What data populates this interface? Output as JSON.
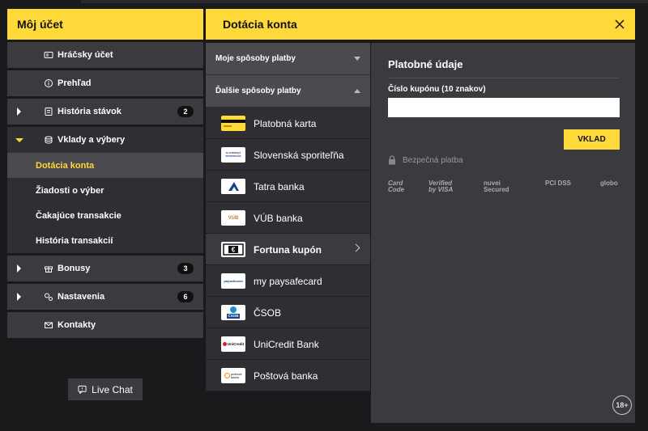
{
  "left_panel": {
    "title": "Môj účet",
    "items": [
      {
        "label": "Hráčsky účet"
      },
      {
        "label": "Prehľad"
      },
      {
        "label": "História stávok",
        "badge": "2"
      },
      {
        "label": "Vklady a výbery"
      },
      {
        "label": "Bonusy",
        "badge": "3"
      },
      {
        "label": "Nastavenia",
        "badge": "6"
      },
      {
        "label": "Kontakty"
      }
    ],
    "submenu": [
      {
        "label": "Dotácia konta"
      },
      {
        "label": "Žiadosti o výber"
      },
      {
        "label": "Čakajúce transakcie"
      },
      {
        "label": "História transakcií"
      }
    ],
    "live_chat": "Live Chat"
  },
  "right_panel": {
    "title": "Dotácia konta",
    "groups": {
      "my_methods": "Moje spôsoby platby",
      "other_methods": "Ďalšie spôsoby platby"
    },
    "methods": [
      {
        "label": "Platobná karta"
      },
      {
        "label": "Slovenská sporiteľňa",
        "logo_text": "SLOVENSKÁ SPORITEĽŇA"
      },
      {
        "label": "Tatra banka"
      },
      {
        "label": "VÚB banka",
        "logo_text": "VÚB"
      },
      {
        "label": "Fortuna kupón"
      },
      {
        "label": "my paysafecard",
        "logo_text": "paysafecard"
      },
      {
        "label": "ČSOB",
        "logo_text": "ČSOB"
      },
      {
        "label": "UniCredit Bank",
        "logo_text": "UniCredit"
      },
      {
        "label": "Poštová banka",
        "logo_text": "poštová banka"
      }
    ],
    "details": {
      "title": "Platobné údaje",
      "field_label": "Číslo kupónu (10 znakov)",
      "field_value": "",
      "deposit_button": "VKLAD",
      "secure_text": "Bezpečná platba",
      "trust_badges": [
        "Card Code",
        "Verified by VISA",
        "nuvei Secured",
        "PCI DSS",
        "globo"
      ],
      "age_badge": "18+"
    }
  },
  "colors": {
    "accent": "#ffd83a",
    "panel": "#3b3b3f",
    "panel_dark": "#2f2f33",
    "background": "#1a1a1c"
  }
}
